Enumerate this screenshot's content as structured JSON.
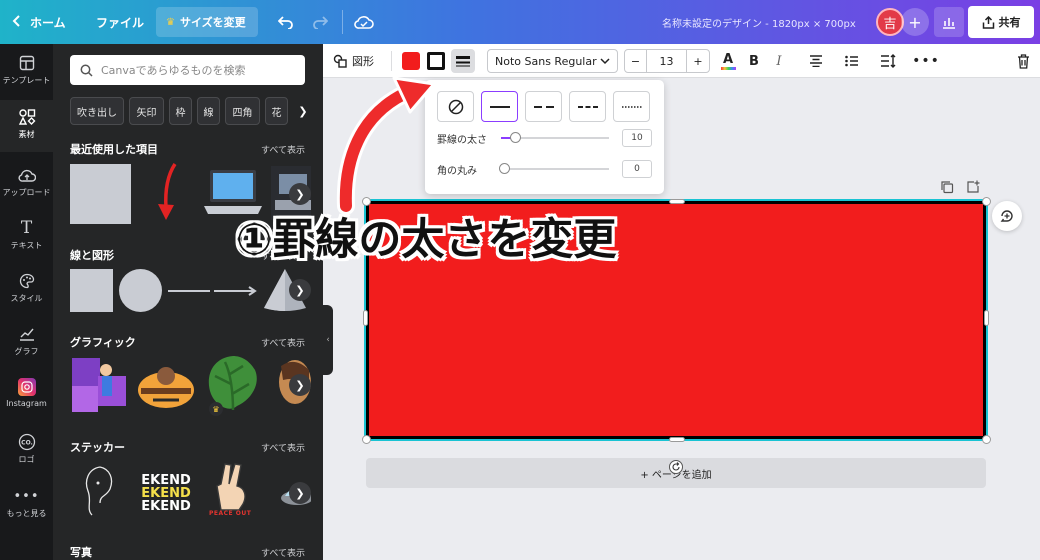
{
  "topbar": {
    "home": "ホーム",
    "file": "ファイル",
    "resize": "サイズを変更",
    "doc_title": "名称未設定のデザイン - 1820px × 700px",
    "avatar": "吉",
    "share": "共有"
  },
  "rail": [
    {
      "label": "テンプレート",
      "icon": "template-icon"
    },
    {
      "label": "素材",
      "icon": "elements-icon"
    },
    {
      "label": "アップロード",
      "icon": "upload-icon"
    },
    {
      "label": "テキスト",
      "icon": "text-icon"
    },
    {
      "label": "スタイル",
      "icon": "palette-icon"
    },
    {
      "label": "グラフ",
      "icon": "chart-icon"
    },
    {
      "label": "Instagram",
      "icon": "instagram-icon"
    },
    {
      "label": "ロゴ",
      "icon": "logo-icon"
    },
    {
      "label": "もっと見る",
      "icon": "more-icon"
    }
  ],
  "panel": {
    "search_placeholder": "Canvaであらゆるものを検索",
    "chips": [
      "吹き出し",
      "矢印",
      "枠",
      "線",
      "四角",
      "花"
    ],
    "see_all": "すべて表示",
    "sections": [
      "最近使用した項目",
      "線と図形",
      "グラフィック",
      "ステッカー",
      "写真"
    ],
    "sticker_text": "EKEND",
    "peace_text": "PEACE OUT"
  },
  "toolbar": {
    "shape_label": "図形",
    "font": "Noto Sans Regular",
    "size": "13",
    "fill_color": "#f21d1d"
  },
  "popup": {
    "border_width_label": "罫線の太さ",
    "border_width_value": "10",
    "corner_label": "角の丸み",
    "corner_value": "0",
    "border_width_fraction": 0.1,
    "corner_fraction": 0.0
  },
  "canvas": {
    "annotation": "①罫線の太さを変更",
    "add_page": "+ ページを追加",
    "box_color": "#f21d1d"
  }
}
